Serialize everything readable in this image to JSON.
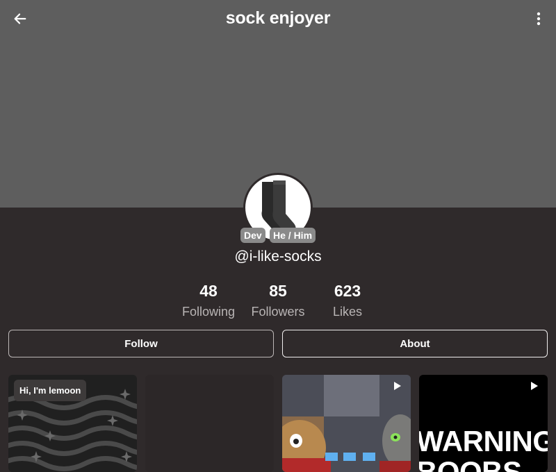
{
  "header": {
    "title": "sock enjoyer",
    "back_icon": "arrow-left-icon",
    "menu_icon": "more-vertical-icon"
  },
  "profile": {
    "handle": "@i-like-socks",
    "avatar_icon": "sock-icon",
    "badges": [
      "Dev",
      "He / Him"
    ]
  },
  "stats": [
    {
      "value": "48",
      "label": "Following"
    },
    {
      "value": "85",
      "label": "Followers"
    },
    {
      "value": "623",
      "label": "Likes"
    }
  ],
  "actions": {
    "follow_label": "Follow",
    "about_label": "About"
  },
  "posts": [
    {
      "caption": "Hi, I'm lemoon",
      "type": "image"
    },
    {
      "type": "empty"
    },
    {
      "type": "video"
    },
    {
      "type": "video",
      "overlay_text": "WARNING\nBOOBS"
    }
  ],
  "colors": {
    "banner": "#5e5e5e",
    "background": "#2f2a2b",
    "badge": "#8a8a8a",
    "muted_text": "#b9b5b5"
  }
}
